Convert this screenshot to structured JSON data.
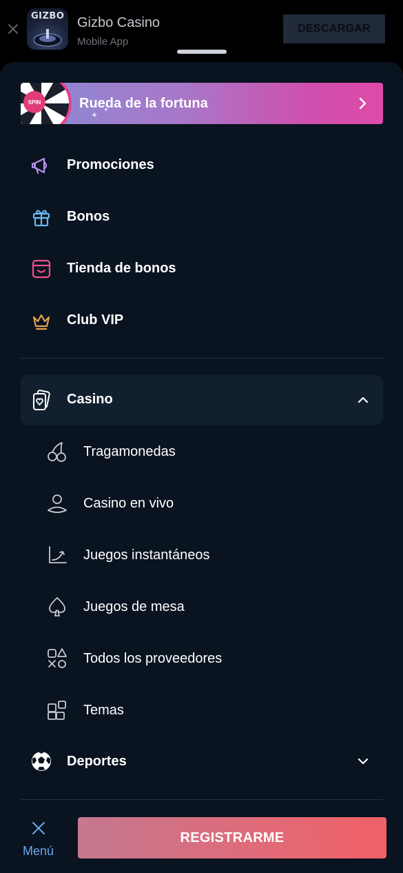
{
  "banner": {
    "app_icon_text": "GIZBO",
    "app_name": "Gizbo Casino",
    "app_subtitle": "Mobile App",
    "download_label": "DESCARGAR"
  },
  "menu": {
    "fortune": {
      "label": "Rueda de la fortuna",
      "badge": "SPIN"
    },
    "items": [
      {
        "label": "Promociones",
        "icon": "megaphone-icon",
        "color": "#b98de8"
      },
      {
        "label": "Bonos",
        "icon": "gift-icon",
        "color": "#6ab8f0"
      },
      {
        "label": "Tienda de bonos",
        "icon": "shop-icon",
        "color": "#f0508a"
      },
      {
        "label": "Club VIP",
        "icon": "crown-icon",
        "color": "#e8a24a"
      }
    ],
    "casino": {
      "label": "Casino",
      "expanded": true,
      "subitems": [
        {
          "label": "Tragamonedas",
          "icon": "cherries-icon"
        },
        {
          "label": "Casino en vivo",
          "icon": "live-dealer-icon"
        },
        {
          "label": "Juegos instantáneos",
          "icon": "rising-chart-icon"
        },
        {
          "label": "Juegos de mesa",
          "icon": "spade-icon"
        },
        {
          "label": "Todos los proveedores",
          "icon": "shapes-icon"
        },
        {
          "label": "Temas",
          "icon": "themes-grid-icon"
        }
      ]
    },
    "sports": {
      "label": "Deportes",
      "expanded": false
    }
  },
  "bottom": {
    "menu_label": "Menú",
    "register_label": "REGISTRARME"
  }
}
